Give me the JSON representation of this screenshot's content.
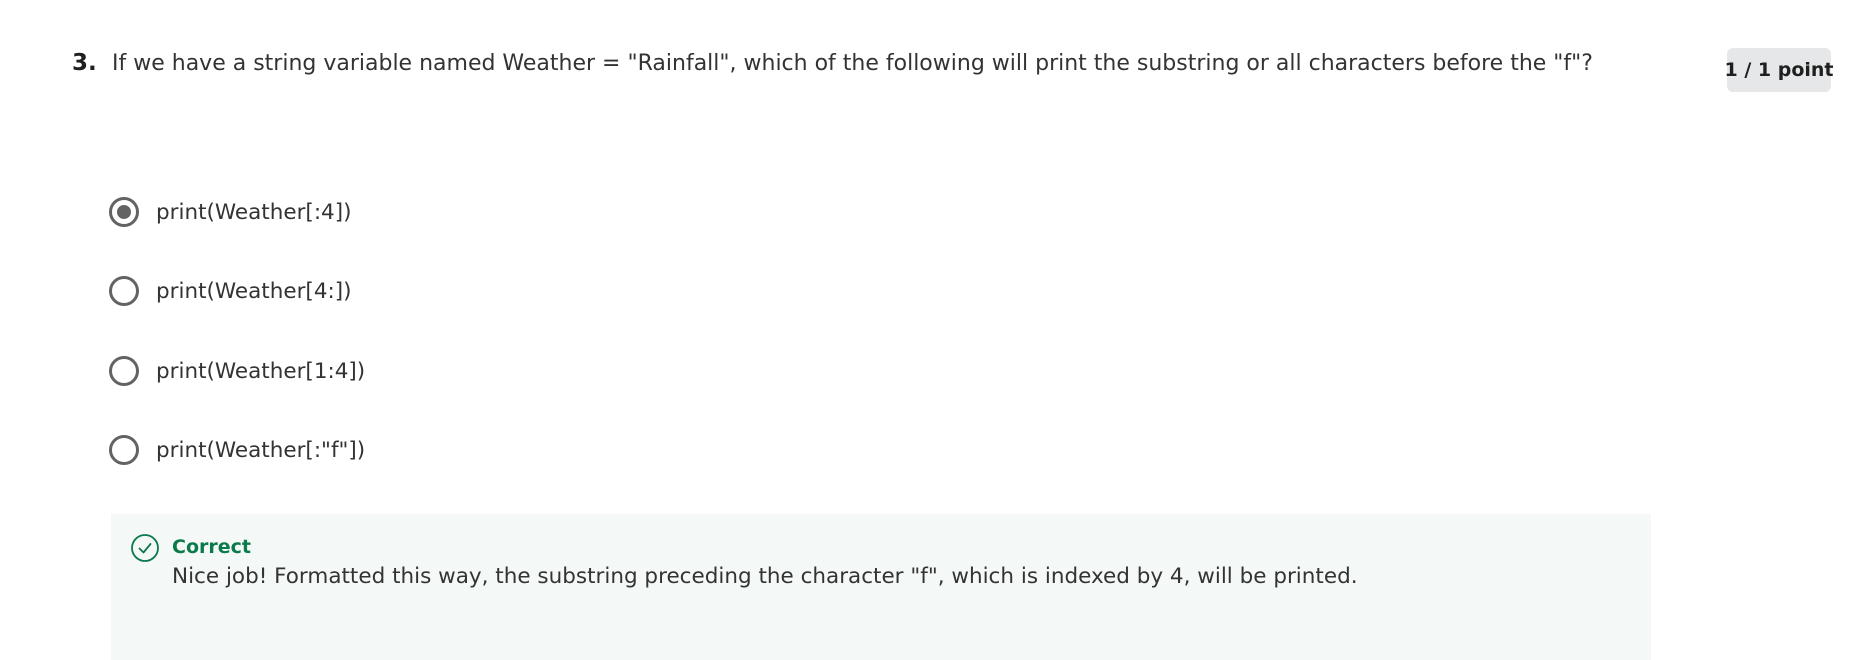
{
  "question": {
    "number": "3.",
    "prompt": "If we have a string variable named Weather = \"Rainfall\", which of the following will print the substring or all characters before the \"f\"?",
    "points": "1 / 1 point"
  },
  "options": [
    {
      "label": "print(Weather[:4])",
      "selected": true
    },
    {
      "label": "print(Weather[4:])",
      "selected": false
    },
    {
      "label": "print(Weather[1:4])",
      "selected": false
    },
    {
      "label": "print(Weather[:\"f\"])",
      "selected": false
    }
  ],
  "feedback": {
    "status": "Correct",
    "icon": "check-circle-icon",
    "message": "Nice job! Formatted this way, the substring preceding the character \"f\", which is indexed by 4, will be printed.",
    "accent_color": "#0b7a4a"
  }
}
